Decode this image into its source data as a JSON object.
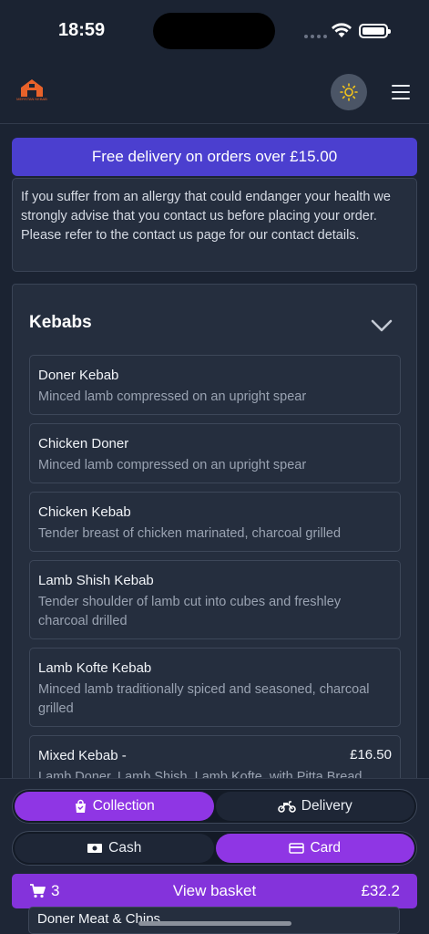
{
  "status": {
    "time": "18:59"
  },
  "header": {
    "logo_text": "MERSTAN KEBAB"
  },
  "promo": {
    "text": "Free delivery on orders over £15.00"
  },
  "allergy": {
    "text": "If you suffer from an allergy that could endanger your health we strongly advise that you contact us before placing your order. Please refer to the contact us page for our contact details."
  },
  "menu": {
    "section_title": "Kebabs",
    "items": [
      {
        "name": "Doner Kebab",
        "desc": "Minced lamb compressed on an upright spear"
      },
      {
        "name": "Chicken Doner",
        "desc": "Minced lamb compressed on an upright spear"
      },
      {
        "name": "Chicken Kebab",
        "desc": "Tender breast of chicken marinated, charcoal grilled"
      },
      {
        "name": "Lamb Shish Kebab",
        "desc": "Tender shoulder of lamb cut into cubes and freshley charcoal drilled"
      },
      {
        "name": "Lamb Kofte Kebab",
        "desc": "Minced lamb traditionally spiced and seasoned, charcoal grilled"
      },
      {
        "name": "Mixed Kebab -",
        "desc": "Lamb Doner, Lamb Shish, Lamb Kofte, with Pitta Bread",
        "price": "£16.50"
      }
    ],
    "peek_item": "Doner Meat & Chips"
  },
  "order_type": {
    "collection": "Collection",
    "delivery": "Delivery",
    "selected": "collection"
  },
  "payment": {
    "cash": "Cash",
    "card": "Card",
    "selected": "card"
  },
  "basket": {
    "count": "3",
    "label": "View basket",
    "total": "£32.2"
  },
  "colors": {
    "accent": "#8f36e4",
    "promo": "#4b3fcf",
    "logo": "#e8622a"
  }
}
